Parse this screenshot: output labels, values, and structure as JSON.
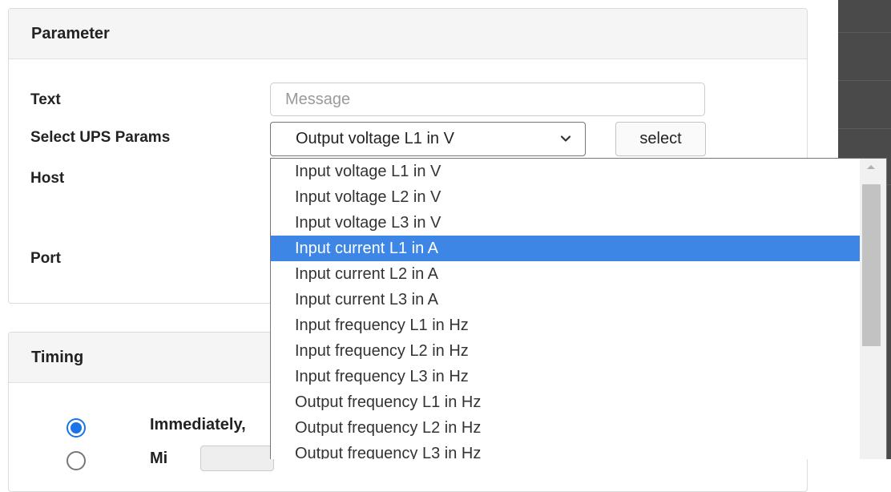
{
  "parameter_panel": {
    "title": "Parameter",
    "labels": {
      "text": "Text",
      "select_ups_params": "Select UPS Params",
      "host": "Host",
      "port": "Port"
    },
    "text_input": {
      "placeholder": "Message",
      "value": ""
    },
    "ups_select": {
      "selected": "Output voltage L1 in V"
    },
    "select_button": "select"
  },
  "dropdown": {
    "highlighted_index": 3,
    "options": [
      "Input voltage L1 in V",
      "Input voltage L2 in V",
      "Input voltage L3 in V",
      "Input current L1 in A",
      "Input current L2 in A",
      "Input current L3 in A",
      "Input frequency L1 in Hz",
      "Input frequency L2 in Hz",
      "Input frequency L3 in Hz",
      "Output frequency L1 in Hz",
      "Output frequency L2 in Hz",
      "Output frequency L3 in Hz"
    ]
  },
  "timing_panel": {
    "title": "Timing",
    "options": [
      {
        "label": "Immediately,",
        "checked": true
      },
      {
        "label": "Mi",
        "checked": false
      }
    ]
  },
  "colors": {
    "highlight": "#3d86e6",
    "radio_accent": "#1a73e8"
  }
}
